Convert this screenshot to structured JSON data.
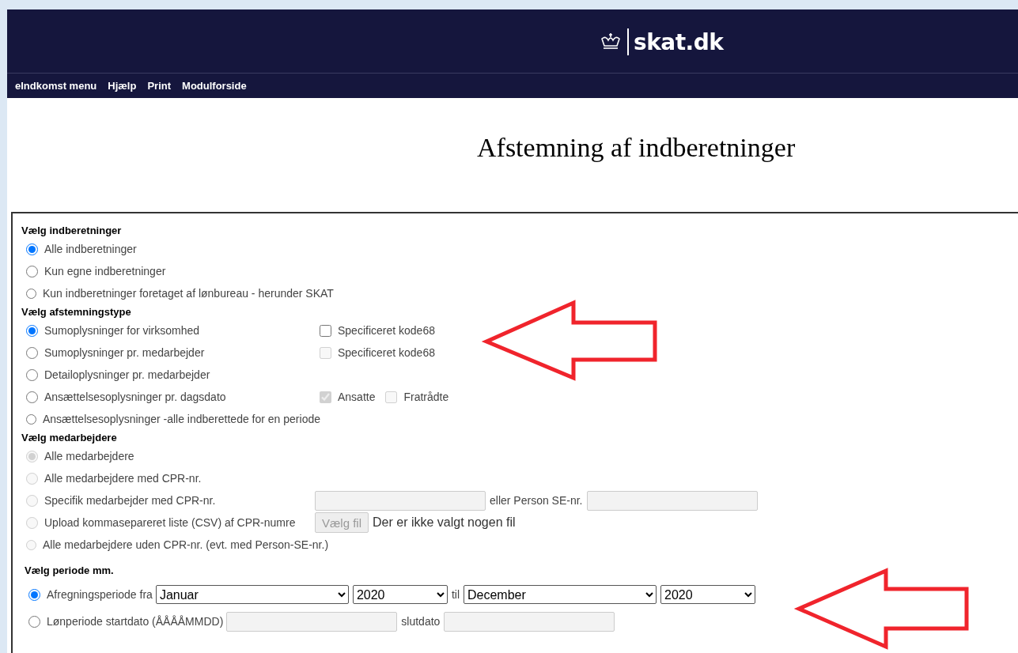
{
  "header": {
    "logo": "skat.dk"
  },
  "menu": [
    "eIndkomst menu",
    "Hjælp",
    "Print",
    "Modulforside"
  ],
  "title": "Afstemning af indberetninger",
  "sections": [
    {
      "heading": "Vælg indberetninger",
      "kind": "columns",
      "rows": [
        {
          "label": "Alle indberetninger",
          "selected": true,
          "disabled": false
        },
        {
          "label": "Kun egne indberetninger",
          "selected": false,
          "disabled": false
        },
        {
          "label": "Kun indberetninger foretaget af lønbureau - herunder SKAT",
          "selected": false,
          "disabled": false
        }
      ]
    },
    {
      "heading": "Vælg afstemningstype",
      "kind": "columns",
      "rows": [
        {
          "label": "Sumoplysninger for virksomhed",
          "selected": true,
          "disabled": false,
          "extras": [
            {
              "kind": "checkbox",
              "label": "Specificeret kode68",
              "checked": false,
              "disabled": false
            }
          ]
        },
        {
          "label": "Sumoplysninger pr. medarbejder",
          "selected": false,
          "disabled": false,
          "extras": [
            {
              "kind": "checkbox",
              "label": "Specificeret kode68",
              "checked": false,
              "disabled": true
            }
          ]
        },
        {
          "label": "Detailoplysninger pr. medarbejder",
          "selected": false,
          "disabled": false
        },
        {
          "label": "Ansættelsesoplysninger pr. dagsdato",
          "selected": false,
          "disabled": false,
          "extras": [
            {
              "kind": "checkbox",
              "label": "Ansatte",
              "checked": true,
              "disabled": true
            },
            {
              "kind": "checkbox",
              "label": "Fratrådte",
              "checked": false,
              "disabled": true
            }
          ]
        },
        {
          "label": "Ansættelsesoplysninger -alle indberettede for en periode",
          "selected": false,
          "disabled": false
        }
      ]
    },
    {
      "heading": "Vælg medarbejdere",
      "kind": "columns",
      "rows": [
        {
          "label": "Alle medarbejdere",
          "selected": true,
          "disabled": true
        },
        {
          "label": "Alle medarbejdere med CPR-nr.",
          "selected": false,
          "disabled": true
        },
        {
          "label": "Specifik medarbejder med CPR-nr.",
          "selected": false,
          "disabled": true,
          "extras": [
            {
              "kind": "field",
              "disabled": true
            },
            {
              "kind": "text",
              "text": "eller Person SE-nr."
            },
            {
              "kind": "field",
              "disabled": true
            }
          ]
        },
        {
          "label": "Upload kommasepareret liste (CSV) af CPR-numre",
          "selected": false,
          "disabled": true,
          "extras": [
            {
              "kind": "file-button",
              "label": "Vælg fil",
              "disabled": true
            },
            {
              "kind": "status-text",
              "text": "Der er ikke valgt nogen fil"
            }
          ]
        },
        {
          "label": "Alle medarbejdere uden CPR-nr. (evt. med Person-SE-nr.)",
          "selected": false,
          "disabled": true
        }
      ]
    },
    {
      "heading": "Vælg periode mm.",
      "kind": "inline",
      "rows": [
        {
          "label": "Afregningsperiode fra",
          "selected": true,
          "disabled": false,
          "extras": [
            {
              "kind": "month-select",
              "value": "Januar"
            },
            {
              "kind": "year-select",
              "value": "2020"
            },
            {
              "kind": "text",
              "text": "til"
            },
            {
              "kind": "month-select",
              "value": "December"
            },
            {
              "kind": "year-select",
              "value": "2020"
            }
          ]
        },
        {
          "label": "Lønperiode startdato (ÅÅÅÅMMDD)",
          "selected": false,
          "disabled": false,
          "extras": [
            {
              "kind": "field",
              "disabled": true
            },
            {
              "kind": "text",
              "text": "slutdato"
            },
            {
              "kind": "field",
              "disabled": true
            }
          ]
        }
      ]
    }
  ]
}
